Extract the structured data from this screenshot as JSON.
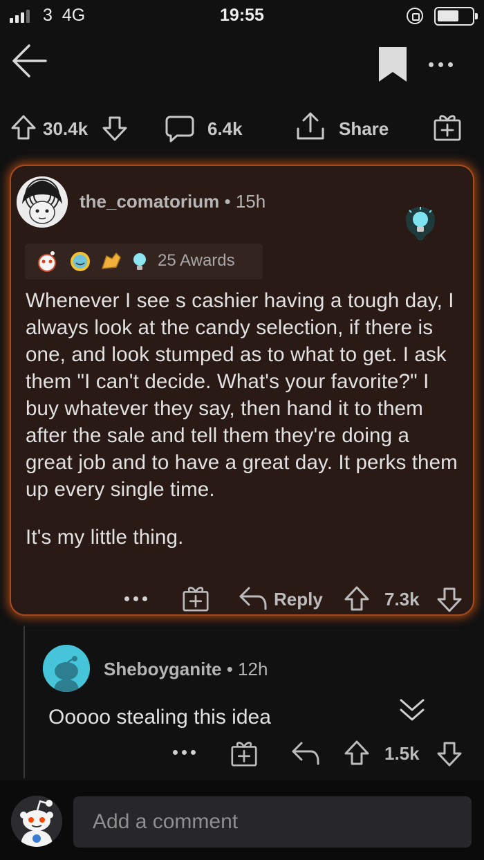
{
  "status_bar": {
    "carrier": "3  4G",
    "time": "19:55"
  },
  "post_actions": {
    "upvotes": "30.4k",
    "comments": "6.4k",
    "share_label": "Share"
  },
  "highlighted_comment": {
    "username": "the_comatorium",
    "age": "15h",
    "awards_label": "25 Awards",
    "paragraphs": [
      "Whenever I see s cashier having a tough day, I always look at the candy selection, if there is one, and look stumped as to what to get. I ask them \"I can't decide. What's your favorite?\" I buy whatever they say, then hand it to them after the sale and tell them they're doing a great job and to have a great day. It perks them up every single time.",
      "It's my little thing."
    ],
    "reply_label": "Reply",
    "score": "7.3k"
  },
  "reply_comment": {
    "username": "Sheboyganite",
    "age": "12h",
    "text": "Ooooo stealing this idea",
    "score": "1.5k"
  },
  "composer": {
    "placeholder": "Add a comment"
  },
  "colors": {
    "background": "#111112",
    "highlight_glow": "#e65f14",
    "card_fill": "#2a1a16"
  },
  "icons": [
    "back-arrow-icon",
    "bookmark-icon",
    "more-icon",
    "upvote-icon",
    "downvote-icon",
    "comment-icon",
    "share-icon",
    "gift-icon",
    "reply-icon",
    "collapse-icon",
    "lightbulb-icon"
  ]
}
